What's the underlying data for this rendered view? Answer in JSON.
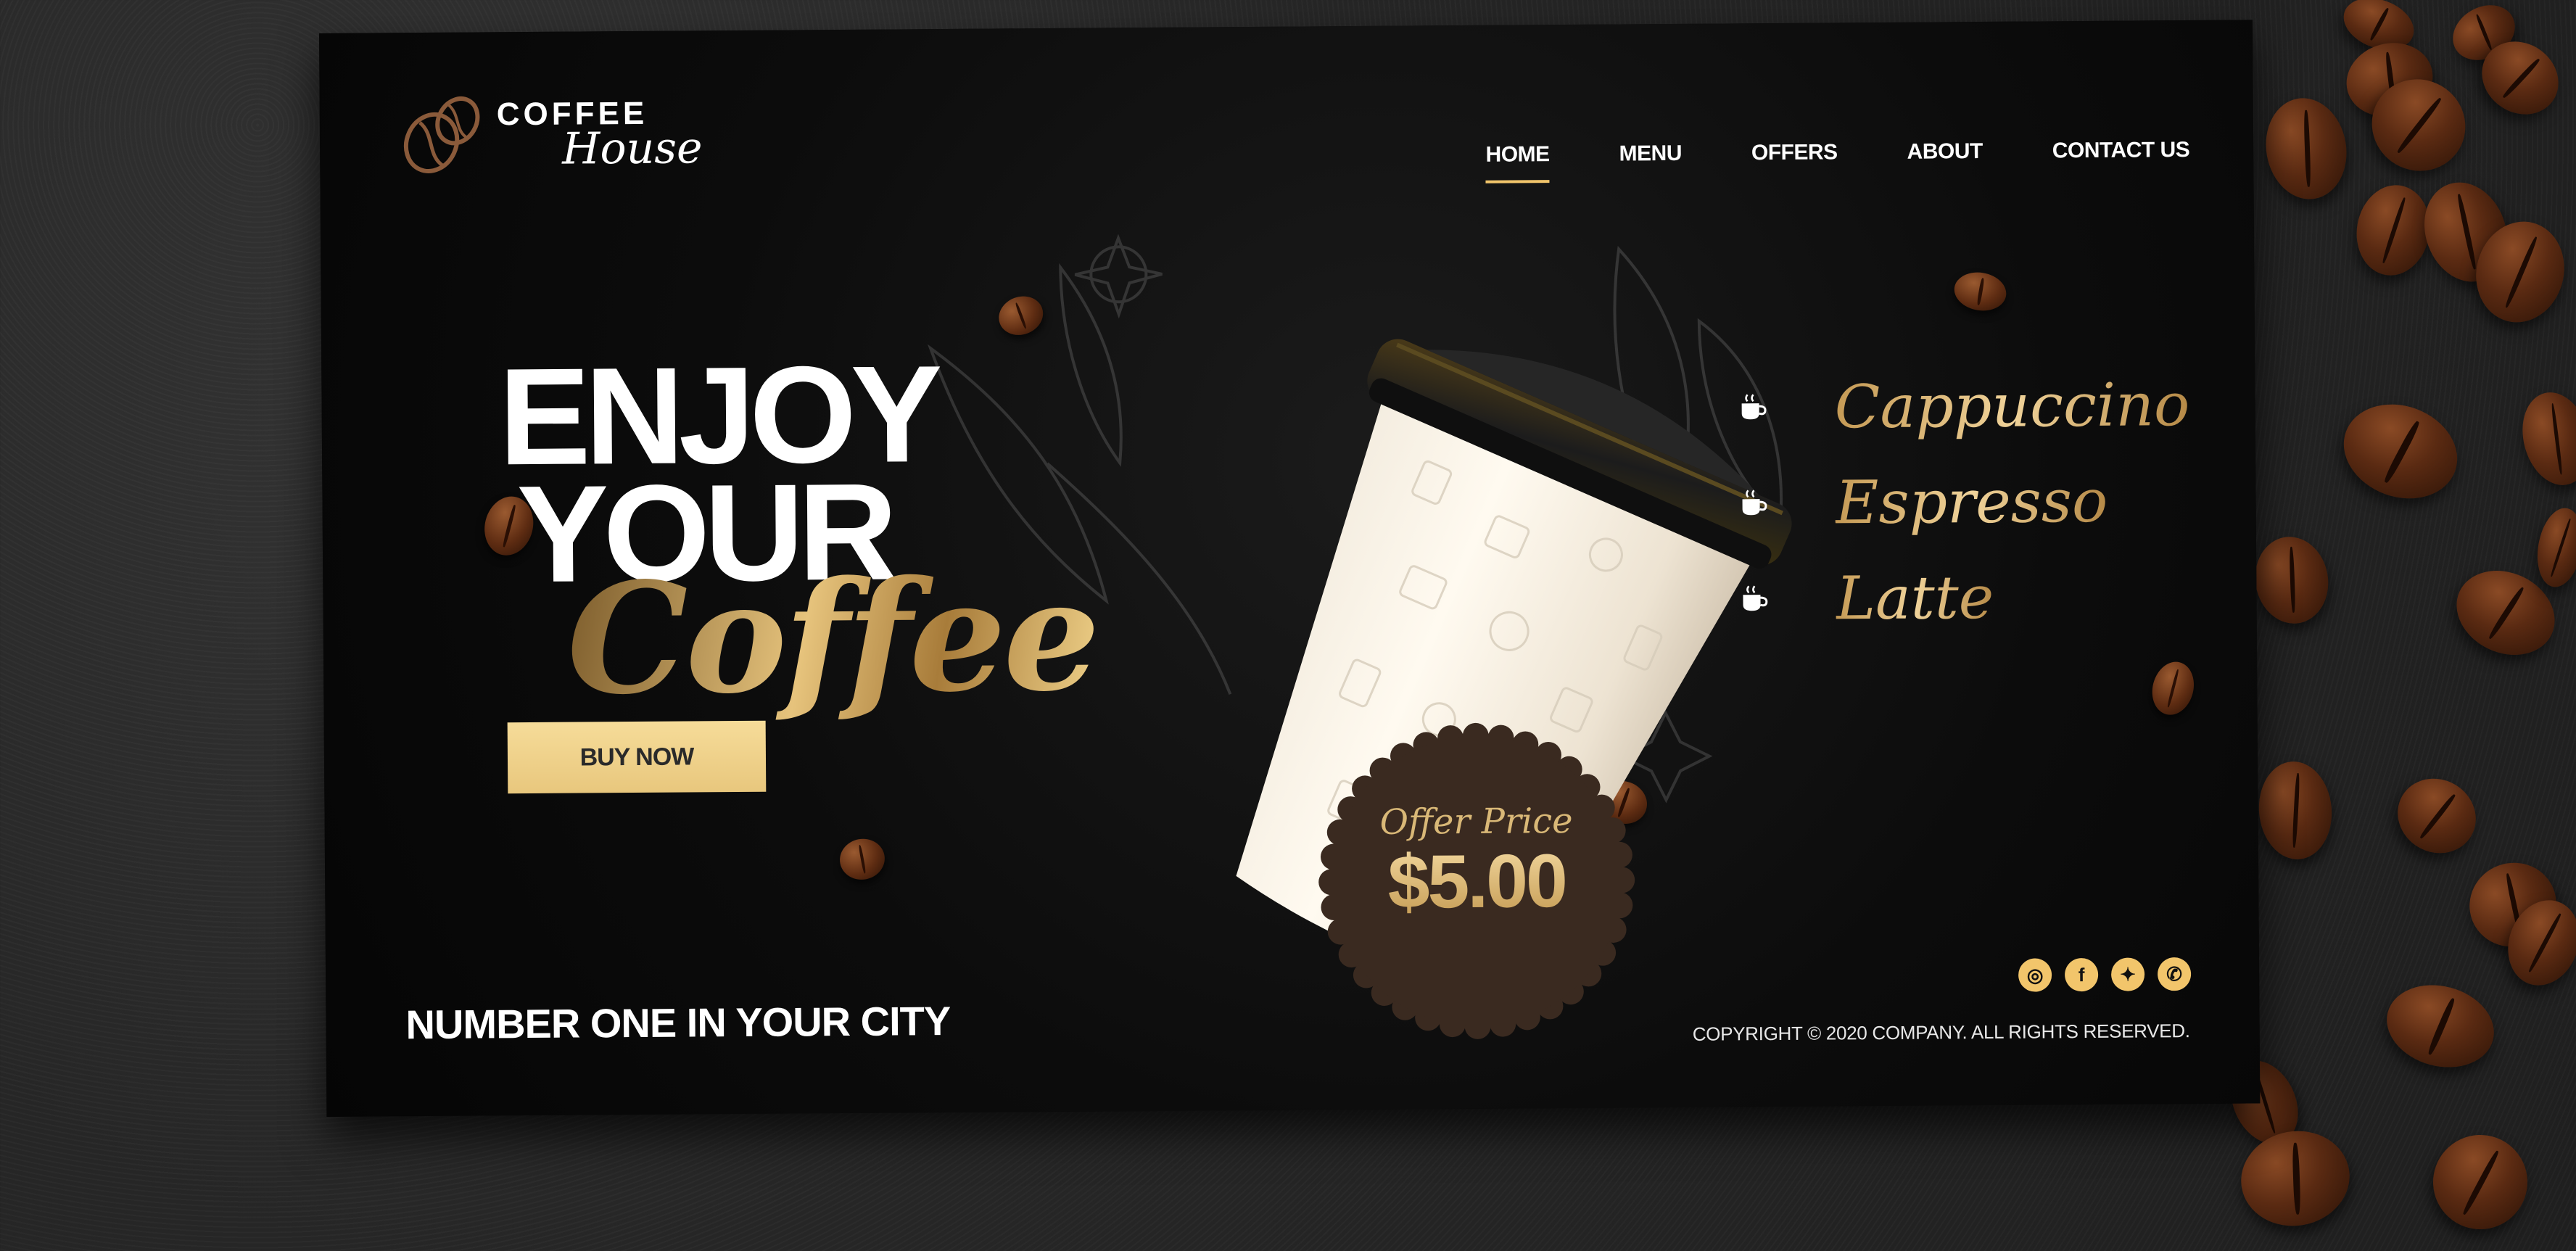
{
  "brand": {
    "name_line1": "COFFEE",
    "name_line2": "House",
    "logo_icon": "coffee-beans-icon"
  },
  "nav": {
    "items": [
      {
        "label": "HOME",
        "active": true
      },
      {
        "label": "MENU",
        "active": false
      },
      {
        "label": "OFFERS",
        "active": false
      },
      {
        "label": "ABOUT",
        "active": false
      },
      {
        "label": "CONTACT US",
        "active": false
      }
    ]
  },
  "hero": {
    "line1": "ENJOY",
    "line2": "YOUR",
    "line3": "Coffee",
    "cta_label": "BUY NOW",
    "tagline": "NUMBER ONE IN YOUR CITY"
  },
  "menu": {
    "icon": "coffee-cup-icon",
    "items": [
      "Cappuccino",
      "Espresso",
      "Latte"
    ]
  },
  "offer": {
    "label": "Offer Price",
    "price": "$5.00"
  },
  "footer": {
    "social": [
      {
        "name": "instagram-icon",
        "glyph": "◎"
      },
      {
        "name": "facebook-icon",
        "glyph": "f"
      },
      {
        "name": "twitter-icon",
        "glyph": "✦"
      },
      {
        "name": "whatsapp-icon",
        "glyph": "✆"
      }
    ],
    "copyright": "COPYRIGHT © 2020  COMPANY. ALL RIGHTS RESERVED."
  },
  "colors": {
    "accent_gold": "#f2c56b",
    "card_bg": "#0b0b0b",
    "offer_badge": "#3a2a20"
  }
}
